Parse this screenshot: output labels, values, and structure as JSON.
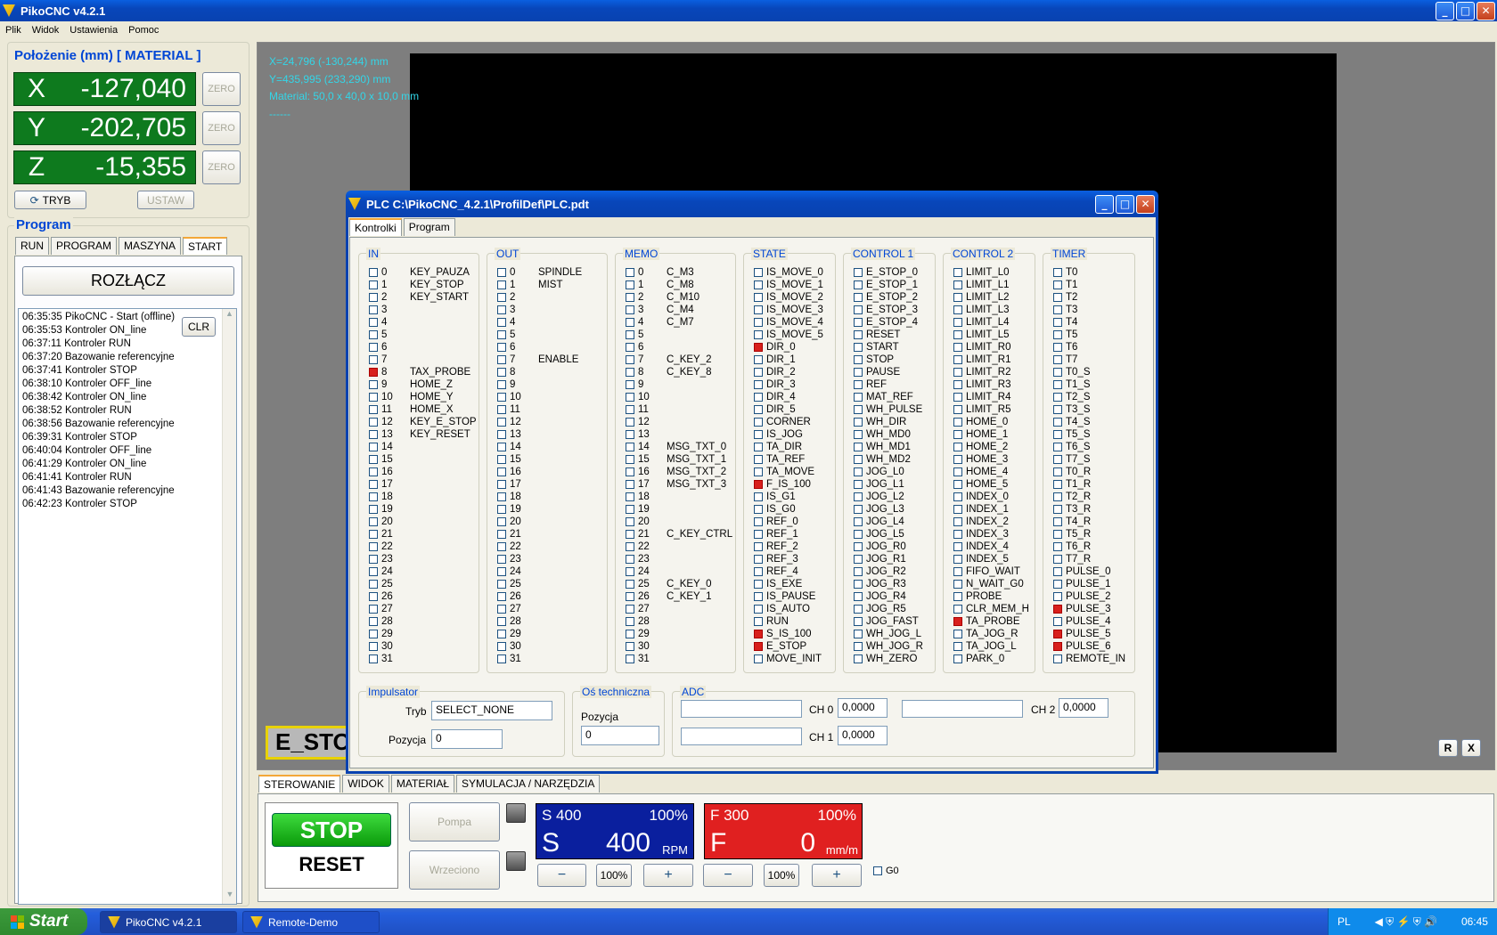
{
  "app": {
    "title": "PikoCNC v4.2.1"
  },
  "menu": [
    "Plik",
    "Widok",
    "Ustawienia",
    "Pomoc"
  ],
  "position": {
    "title": "Położenie (mm) [ MATERIAL ]",
    "axes": [
      {
        "label": "X",
        "value": "-127,040",
        "zero": "ZERO"
      },
      {
        "label": "Y",
        "value": "-202,705",
        "zero": "ZERO"
      },
      {
        "label": "Z",
        "value": "-15,355",
        "zero": "ZERO"
      }
    ],
    "tryb": "TRYB",
    "ustaw": "USTAW"
  },
  "program": {
    "title": "Program",
    "tabs": [
      "RUN",
      "PROGRAM",
      "MASZYNA",
      "START"
    ],
    "disconnect": "ROZŁĄCZ",
    "clr": "CLR",
    "log": [
      "06:35:35 PikoCNC - Start (offline)",
      "06:35:53 Kontroler ON_line",
      "06:37:11 Kontroler RUN",
      "06:37:20 Bazowanie referencyjne",
      "06:37:41 Kontroler STOP",
      "06:38:10 Kontroler OFF_line",
      "06:38:42 Kontroler ON_line",
      "06:38:52 Kontroler RUN",
      "06:38:56 Bazowanie referencyjne",
      "06:39:31 Kontroler STOP",
      "06:40:04 Kontroler OFF_line",
      "06:41:29 Kontroler ON_line",
      "06:41:41 Kontroler RUN",
      "06:41:43 Bazowanie referencyjne",
      "06:42:23 Kontroler STOP"
    ]
  },
  "viewport": {
    "line1": "X=24,796 (-130,244) mm",
    "line2": "Y=435,995 (233,290) mm",
    "line3": "Material: 50,0 x 40,0 x 10,0 mm",
    "line4": "------",
    "estop": "E_STO",
    "btn_r": "R",
    "btn_x": "X"
  },
  "plc": {
    "title": "PLC C:\\PikoCNC_4.2.1\\ProfilDef\\PLC.pdt",
    "tabs": [
      "Kontrolki",
      "Program"
    ],
    "columns": [
      {
        "title": "IN",
        "labels": [
          "KEY_PAUZA",
          "KEY_STOP",
          "KEY_START",
          "",
          "",
          "",
          "",
          "",
          "TAX_PROBE",
          "HOME_Z",
          "HOME_Y",
          "HOME_X",
          "KEY_E_STOP",
          "KEY_RESET",
          "",
          "",
          "",
          "",
          "",
          "",
          "",
          "",
          "",
          "",
          "",
          "",
          "",
          "",
          "",
          "",
          "",
          ""
        ],
        "on": [
          8
        ]
      },
      {
        "title": "OUT",
        "labels": [
          "SPINDLE",
          "MIST",
          "",
          "",
          "",
          "",
          "",
          "ENABLE",
          "",
          "",
          "",
          "",
          "",
          "",
          "",
          "",
          "",
          "",
          "",
          "",
          "",
          "",
          "",
          "",
          "",
          "",
          "",
          "",
          "",
          "",
          "",
          ""
        ],
        "on": []
      },
      {
        "title": "MEMO",
        "labels": [
          "C_M3",
          "C_M8",
          "C_M10",
          "C_M4",
          "C_M7",
          "",
          "",
          "C_KEY_2",
          "C_KEY_8",
          "",
          "",
          "",
          "",
          "",
          "MSG_TXT_0",
          "MSG_TXT_1",
          "MSG_TXT_2",
          "MSG_TXT_3",
          "",
          "",
          "",
          "C_KEY_CTRL",
          "",
          "",
          "",
          "C_KEY_0",
          "C_KEY_1",
          "",
          "",
          "",
          "",
          ""
        ],
        "on": []
      },
      {
        "title": "STATE",
        "labels": [
          "IS_MOVE_0",
          "IS_MOVE_1",
          "IS_MOVE_2",
          "IS_MOVE_3",
          "IS_MOVE_4",
          "IS_MOVE_5",
          "DIR_0",
          "DIR_1",
          "DIR_2",
          "DIR_3",
          "DIR_4",
          "DIR_5",
          "CORNER",
          "IS_JOG",
          "TA_DIR",
          "TA_REF",
          "TA_MOVE",
          "F_IS_100",
          "IS_G1",
          "IS_G0",
          "REF_0",
          "REF_1",
          "REF_2",
          "REF_3",
          "REF_4",
          "IS_EXE",
          "IS_PAUSE",
          "IS_AUTO",
          "RUN",
          "S_IS_100",
          "E_STOP",
          "MOVE_INIT"
        ],
        "on": [
          6,
          17,
          29,
          30
        ]
      },
      {
        "title": "CONTROL 1",
        "labels": [
          "E_STOP_0",
          "E_STOP_1",
          "E_STOP_2",
          "E_STOP_3",
          "E_STOP_4",
          "RESET",
          "START",
          "STOP",
          "PAUSE",
          "REF",
          "MAT_REF",
          "WH_PULSE",
          "WH_DIR",
          "WH_MD0",
          "WH_MD1",
          "WH_MD2",
          "JOG_L0",
          "JOG_L1",
          "JOG_L2",
          "JOG_L3",
          "JOG_L4",
          "JOG_L5",
          "JOG_R0",
          "JOG_R1",
          "JOG_R2",
          "JOG_R3",
          "JOG_R4",
          "JOG_R5",
          "JOG_FAST",
          "WH_JOG_L",
          "WH_JOG_R",
          "WH_ZERO"
        ],
        "on": []
      },
      {
        "title": "CONTROL 2",
        "labels": [
          "LIMIT_L0",
          "LIMIT_L1",
          "LIMIT_L2",
          "LIMIT_L3",
          "LIMIT_L4",
          "LIMIT_L5",
          "LIMIT_R0",
          "LIMIT_R1",
          "LIMIT_R2",
          "LIMIT_R3",
          "LIMIT_R4",
          "LIMIT_R5",
          "HOME_0",
          "HOME_1",
          "HOME_2",
          "HOME_3",
          "HOME_4",
          "HOME_5",
          "INDEX_0",
          "INDEX_1",
          "INDEX_2",
          "INDEX_3",
          "INDEX_4",
          "INDEX_5",
          "FIFO_WAIT",
          "N_WAIT_G0",
          "PROBE",
          "CLR_MEM_H",
          "TA_PROBE",
          "TA_JOG_R",
          "TA_JOG_L",
          "PARK_0"
        ],
        "on": [
          28
        ]
      },
      {
        "title": "TIMER",
        "labels": [
          "T0",
          "T1",
          "T2",
          "T3",
          "T4",
          "T5",
          "T6",
          "T7",
          "T0_S",
          "T1_S",
          "T2_S",
          "T3_S",
          "T4_S",
          "T5_S",
          "T6_S",
          "T7_S",
          "T0_R",
          "T1_R",
          "T2_R",
          "T3_R",
          "T4_R",
          "T5_R",
          "T6_R",
          "T7_R",
          "PULSE_0",
          "PULSE_1",
          "PULSE_2",
          "PULSE_3",
          "PULSE_4",
          "PULSE_5",
          "PULSE_6",
          "REMOTE_IN"
        ],
        "on": [
          27,
          29,
          30
        ]
      }
    ],
    "impulsator": {
      "title": "Impulsator",
      "tryb_label": "Tryb",
      "tryb_value": "SELECT_NONE",
      "pozycja_label": "Pozycja",
      "pozycja_value": "0"
    },
    "os": {
      "title": "Oś techniczna",
      "pozycja_label": "Pozycja",
      "pozycja_value": "0"
    },
    "adc": {
      "title": "ADC",
      "ch0_label": "CH 0",
      "ch0_value": "0,0000",
      "ch1_label": "CH 1",
      "ch1_value": "0,0000",
      "ch2_label": "CH 2",
      "ch2_value": "0,0000"
    }
  },
  "bottom": {
    "tabs": [
      "STEROWANIE",
      "WIDOK",
      "MATERIAŁ",
      "SYMULACJA / NARZĘDZIA"
    ],
    "stop": "STOP",
    "reset": "RESET",
    "pompa": "Pompa",
    "wrzeciono": "Wrzeciono",
    "spindle": {
      "header": "S 400",
      "pct": "100%",
      "letter": "S",
      "value": "400",
      "unit": "RPM",
      "minus": "−",
      "mid": "100%",
      "plus": "+"
    },
    "feed": {
      "header": "F 300",
      "pct": "100%",
      "letter": "F",
      "value": "0",
      "unit": "mm/m",
      "minus": "−",
      "mid": "100%",
      "plus": "+"
    },
    "g0": "G0"
  },
  "taskbar": {
    "start": "Start",
    "items": [
      "PikoCNC v4.2.1",
      "Remote-Demo"
    ],
    "lang": "PL",
    "time": "06:45"
  },
  "colors": {
    "accent_title": "#0046D5",
    "axis_bg": "#0E7A1E",
    "spindle_bg": "#0A1F9E",
    "feed_bg": "#E02020",
    "led_on": "#D8201C"
  }
}
